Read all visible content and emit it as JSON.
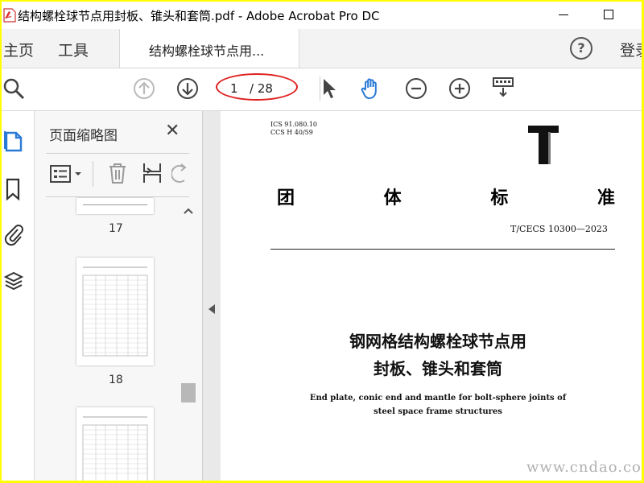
{
  "window": {
    "title": "结构螺栓球节点用封板、锥头和套筒.pdf - Adobe Acrobat Pro DC"
  },
  "tabs": {
    "home": "主页",
    "tools": "工具",
    "document": "结构螺栓球节点用...",
    "login": "登录"
  },
  "toolbar": {
    "page_current": "1",
    "page_total": "/ 28",
    "icons": [
      "search-icon",
      "prev-page-icon",
      "next-page-icon",
      "select-arrow-icon",
      "hand-tool-icon",
      "zoom-out-icon",
      "zoom-in-icon",
      "keyboard-scroll-icon"
    ]
  },
  "panel": {
    "title": "页面缩略图",
    "thumbnails": [
      {
        "label": "17"
      },
      {
        "label": "18"
      }
    ]
  },
  "document": {
    "ics": "ICS 91.080.10",
    "ccs": "CCS H 40/59",
    "headline": [
      "团",
      "体",
      "标",
      "准"
    ],
    "standard_no": "T/CECS 10300—2023",
    "title_cn_line1": "钢网格结构螺栓球节点用",
    "title_cn_line2": "封板、锥头和套筒",
    "title_en_line1": "End plate, conic end and mantle for bolt-sphere joints of",
    "title_en_line2": "steel space frame structures"
  },
  "watermark": "www.cndao.com",
  "colors": {
    "frame": "#ffff00",
    "annotation_circle": "#e02020",
    "hand_tool_active": "#2a7ad6"
  }
}
